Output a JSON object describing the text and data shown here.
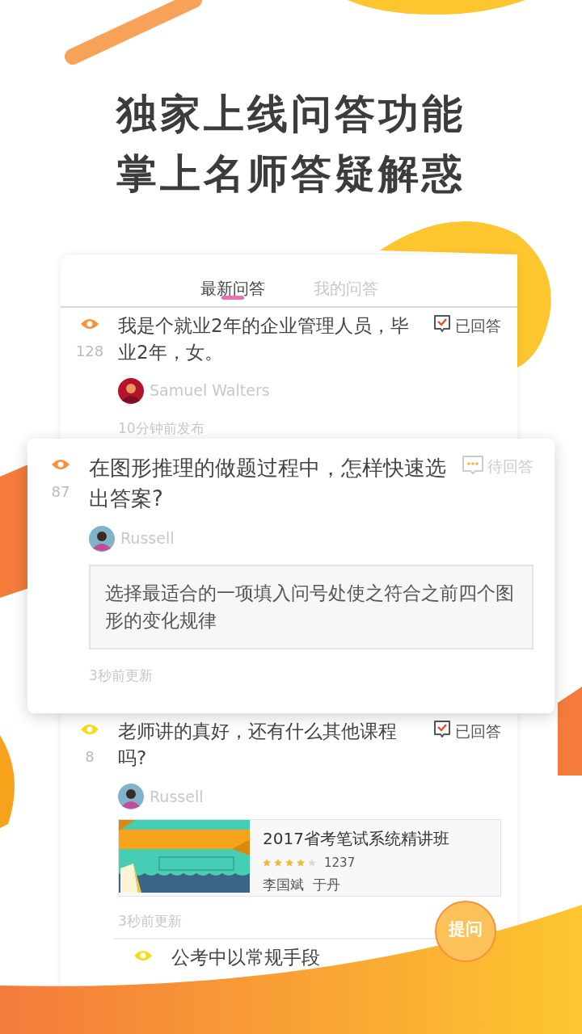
{
  "headline": [
    "独家上线问答功能",
    "掌上名师答疑解惑"
  ],
  "tabs": [
    {
      "label": "最新问答",
      "selected": true
    },
    {
      "label": "我的问答",
      "selected": false
    }
  ],
  "questions": [
    {
      "views": "128",
      "color": "#f7913d",
      "question": "我是个就业2年的企业管理人员，毕业2年，女。",
      "status": {
        "kind": "answered",
        "label": "已回答"
      },
      "author": "Samuel Walters",
      "time": "10分钟前发布",
      "elevated": false
    },
    {
      "views": "87",
      "color": "#f7913d",
      "question": "在图形推理的做题过程中，怎样快速选出答案?",
      "status": {
        "kind": "pending",
        "label": "待回答"
      },
      "author": "Russell",
      "answer": "选择最适合的一项填入问号处使之符合之前四个图形的变化规律",
      "time": "3秒前更新",
      "elevated": true
    },
    {
      "views": "8",
      "color": "#f5dc14",
      "question": "老师讲的真好，还有什么其他课程吗?",
      "status": {
        "kind": "answered",
        "label": "已回答"
      },
      "author": "Russell",
      "course": {
        "title": "2017省考笔试系统精讲班",
        "stars": 4,
        "count": "1237",
        "teachers": "李国斌  于丹"
      },
      "time": "3秒前更新",
      "elevated": false
    },
    {
      "color": "#f5dc14",
      "question": "公考中以常规手段",
      "elevated": false
    }
  ],
  "ask_button": "提问"
}
